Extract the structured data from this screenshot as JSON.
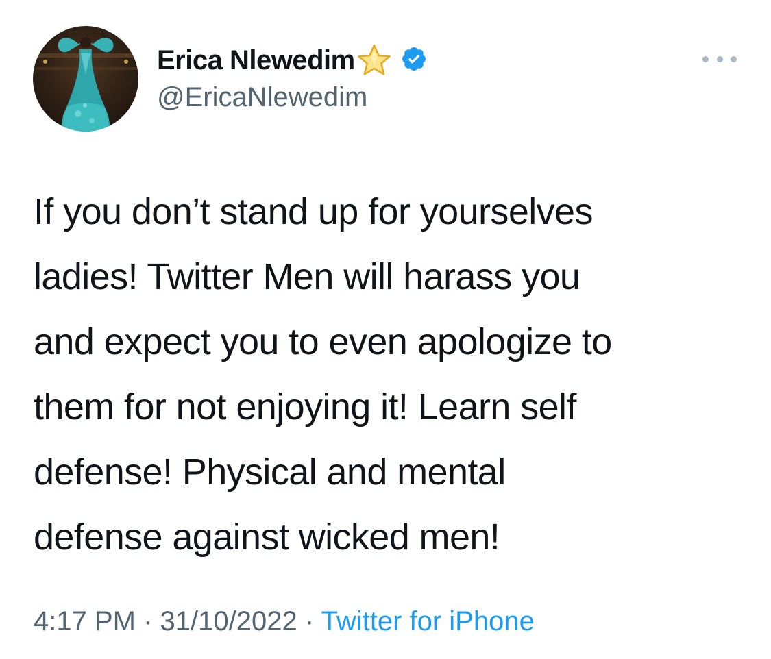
{
  "user": {
    "display_name": "Erica Nlewedim",
    "handle": "@EricaNlewedim",
    "emoji_icon": "star-icon",
    "verified_icon": "verified-badge-icon",
    "verified_color": "#1d9bf0"
  },
  "tweet": {
    "text": "If you don’t stand up for yourselves\nladies! Twitter Men will harass you\nand expect you to even apologize to\nthem for not enjoying it! Learn self\ndefense! Physical and mental\ndefense against wicked men!"
  },
  "meta": {
    "time": "4:17 PM",
    "separator": "·",
    "date": "31/10/2022",
    "source": "Twitter for iPhone"
  },
  "colors": {
    "text": "#0f1419",
    "secondary": "#536471",
    "link": "#1d9bf0",
    "more_dots": "#aab8c2"
  },
  "more_icon": "more-options-icon"
}
